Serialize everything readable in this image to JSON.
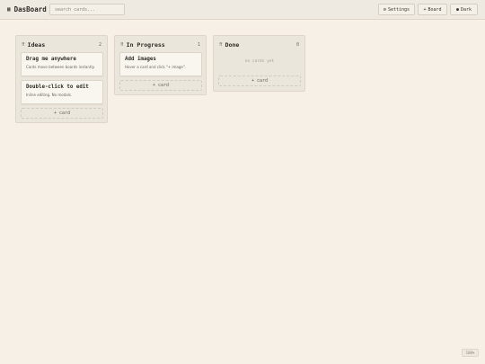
{
  "app": {
    "logo_icon": "grid-icon",
    "title": "DasBoard"
  },
  "search": {
    "placeholder": "search cards..."
  },
  "toolbar": {
    "settings_label": "Settings",
    "board_label": "Board",
    "dark_label": "Dark"
  },
  "columns": [
    {
      "title": "Ideas",
      "count": "2",
      "cards": [
        {
          "title": "Drag me anywhere",
          "desc": "Cards move between boards instantly."
        },
        {
          "title": "Double-click to edit",
          "desc": "Inline editing. No modals."
        }
      ],
      "add_label": "+ card"
    },
    {
      "title": "In Progress",
      "count": "1",
      "cards": [
        {
          "title": "Add images",
          "desc": "Hover a card and click \"+ image\"."
        }
      ],
      "add_label": "+ card"
    },
    {
      "title": "Done",
      "count": "0",
      "empty_text": "no cards yet",
      "add_label": "+ card"
    }
  ],
  "zoom": {
    "value": "100%"
  },
  "colors": {
    "background": "#f6f0e7",
    "topbar": "#eeeae1",
    "column": "#ebe6dc",
    "card": "#f9f6f0",
    "text": "#2e2a24"
  }
}
